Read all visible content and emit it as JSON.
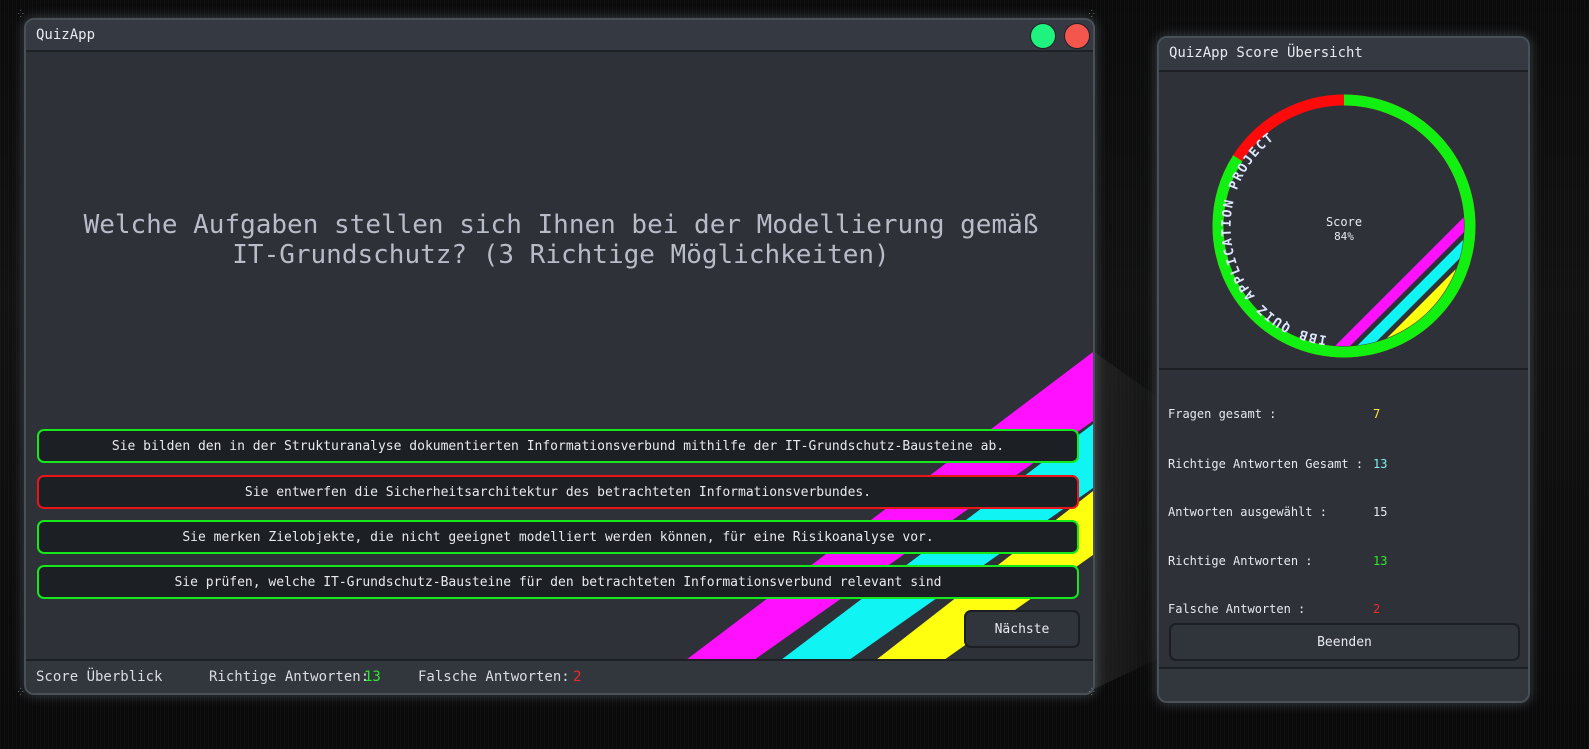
{
  "main_window": {
    "title": "QuizApp",
    "question": "Welche Aufgaben stellen sich Ihnen bei der Modellierung gemäß IT-Grundschutz? (3 Richtige Möglichkeiten)",
    "answers": [
      {
        "text": "Sie bilden den in der Strukturanalyse dokumentierten Informationsverbund mithilfe der IT-Grundschutz-Bausteine ab.",
        "state": "correct"
      },
      {
        "text": "Sie entwerfen die Sicherheitsarchitektur des betrachteten Informationsverbundes.",
        "state": "wrong"
      },
      {
        "text": "Sie merken Zielobjekte, die nicht geeignet modelliert werden können, für eine Risikoanalyse vor.",
        "state": "correct"
      },
      {
        "text": "Sie prüfen, welche IT-Grundschutz-Bausteine für den betrachteten Informationsverbund relevant sind",
        "state": "correct"
      }
    ],
    "next_label": "Nächste",
    "statusbar": {
      "score_label": "Score Überblick",
      "correct_label": "Richtige Antworten:",
      "correct_value": "13",
      "wrong_label": "Falsche Antworten:",
      "wrong_value": "2"
    }
  },
  "score_window": {
    "title": "QuizApp Score Übersicht",
    "ring_text": "IBB QUIZ APPLICATION PROJECT",
    "score_label": "Score",
    "score_value": "84%",
    "score_fraction": 0.84,
    "stats": [
      {
        "label": "Fragen gesamt :",
        "value": "7",
        "color": "#ffe640"
      },
      {
        "label": "Richtige Antworten Gesamt :",
        "value": "13",
        "color": "#7ff0f0"
      },
      {
        "label": "Antworten ausgewählt :",
        "value": "15",
        "color": "#e6e9ee"
      },
      {
        "label": "Richtige Antworten :",
        "value": "13",
        "color": "#2ee82e"
      },
      {
        "label": "Falsche Antworten :",
        "value": "2",
        "color": "#f02a2a"
      }
    ],
    "finish_label": "Beenden"
  },
  "colors": {
    "correct": "#15e81b",
    "wrong": "#e81616",
    "stripe_magenta": "#ff10ff",
    "stripe_cyan": "#10f4f4",
    "stripe_yellow": "#ffff10"
  }
}
